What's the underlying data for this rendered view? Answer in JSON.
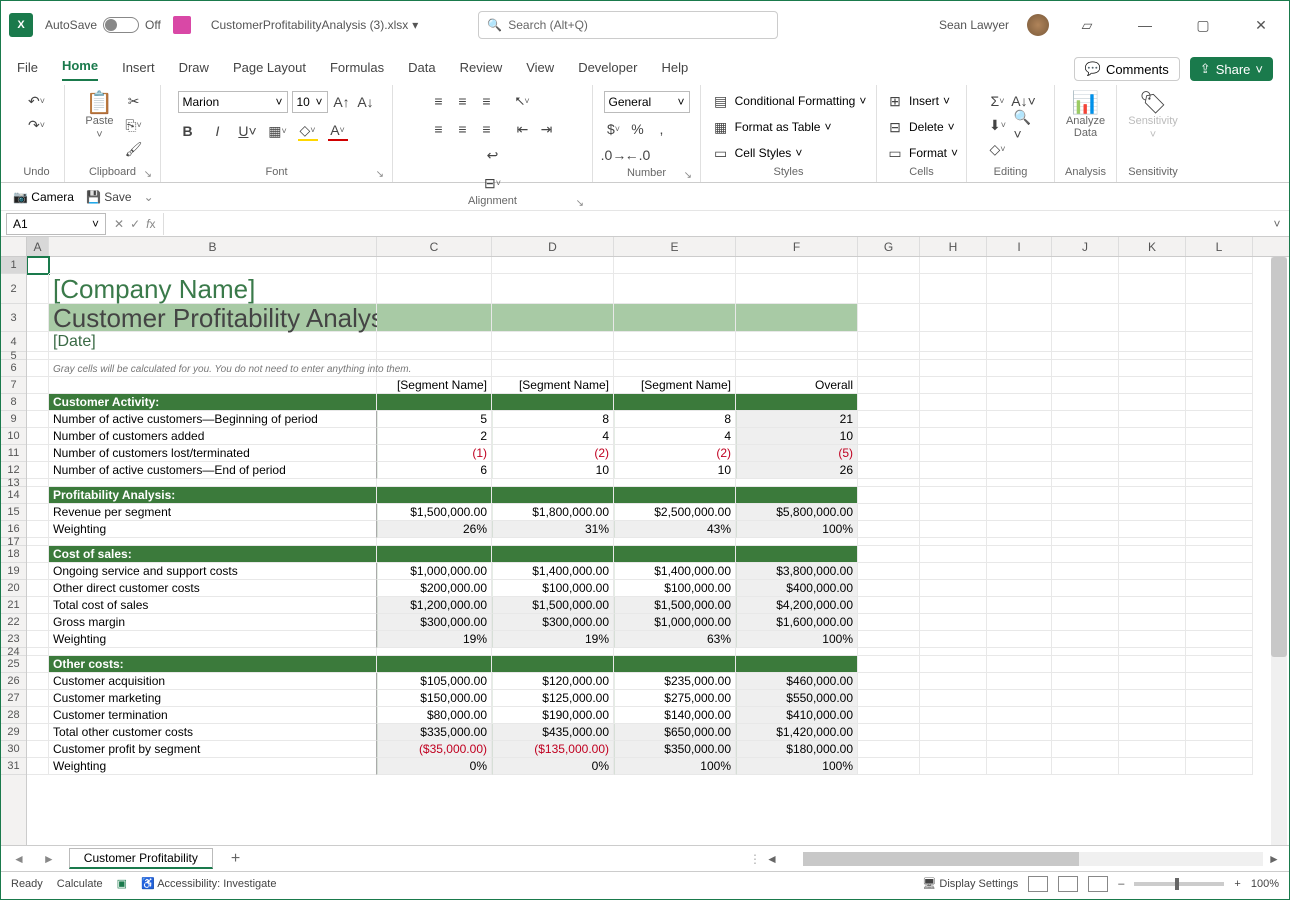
{
  "titlebar": {
    "autosave_label": "AutoSave",
    "autosave_state": "Off",
    "filename": "CustomerProfitabilityAnalysis (3).xlsx",
    "search_placeholder": "Search (Alt+Q)",
    "username": "Sean Lawyer"
  },
  "tabs": {
    "items": [
      "File",
      "Home",
      "Insert",
      "Draw",
      "Page Layout",
      "Formulas",
      "Data",
      "Review",
      "View",
      "Developer",
      "Help"
    ],
    "comments": "Comments",
    "share": "Share"
  },
  "ribbon": {
    "undo": "Undo",
    "clipboard": "Clipboard",
    "paste": "Paste",
    "font_group": "Font",
    "font_name": "Marion",
    "font_size": "10",
    "alignment": "Alignment",
    "number": "Number",
    "number_format": "General",
    "styles": "Styles",
    "cond_fmt": "Conditional Formatting",
    "fmt_table": "Format as Table",
    "cell_styles": "Cell Styles",
    "cells": "Cells",
    "insert": "Insert",
    "delete": "Delete",
    "format": "Format",
    "editing": "Editing",
    "analysis": "Analysis",
    "analyze": "Analyze\nData",
    "sensitivity": "Sensitivity"
  },
  "qat": {
    "camera": "Camera",
    "save": "Save"
  },
  "namebox": "A1",
  "columns": [
    "A",
    "B",
    "C",
    "D",
    "E",
    "F",
    "G",
    "H",
    "I",
    "J",
    "K",
    "L"
  ],
  "sheet": {
    "company": "[Company Name]",
    "title": "Customer Profitability Analysis",
    "date": "[Date]",
    "helper": "Gray cells will be calculated for you. You do not need to enter anything into them.",
    "seg_hdrs": [
      "[Segment Name]",
      "[Segment Name]",
      "[Segment Name]",
      "Overall"
    ],
    "s1": {
      "h": "Customer Activity:",
      "rows": [
        {
          "l": "Number of active customers—Beginning of period",
          "v": [
            "5",
            "8",
            "8",
            "21"
          ]
        },
        {
          "l": "Number of customers added",
          "v": [
            "2",
            "4",
            "4",
            "10"
          ]
        },
        {
          "l": "Number of customers lost/terminated",
          "v": [
            "(1)",
            "(2)",
            "(2)",
            "(5)"
          ],
          "neg": true
        },
        {
          "l": "Number of active customers—End of period",
          "v": [
            "6",
            "10",
            "10",
            "26"
          ]
        }
      ]
    },
    "s2": {
      "h": "Profitability Analysis:",
      "rows": [
        {
          "l": "Revenue per segment",
          "v": [
            "$1,500,000.00",
            "$1,800,000.00",
            "$2,500,000.00",
            "$5,800,000.00"
          ]
        },
        {
          "l": "Weighting",
          "v": [
            "26%",
            "31%",
            "43%",
            "100%"
          ],
          "gray": true
        }
      ]
    },
    "s3": {
      "h": "Cost of sales:",
      "rows": [
        {
          "l": "Ongoing service and support costs",
          "v": [
            "$1,000,000.00",
            "$1,400,000.00",
            "$1,400,000.00",
            "$3,800,000.00"
          ]
        },
        {
          "l": "Other direct customer costs",
          "v": [
            "$200,000.00",
            "$100,000.00",
            "$100,000.00",
            "$400,000.00"
          ]
        },
        {
          "l": "Total cost of sales",
          "v": [
            "$1,200,000.00",
            "$1,500,000.00",
            "$1,500,000.00",
            "$4,200,000.00"
          ],
          "gray": true
        },
        {
          "l": "Gross margin",
          "v": [
            "$300,000.00",
            "$300,000.00",
            "$1,000,000.00",
            "$1,600,000.00"
          ],
          "gray": true
        },
        {
          "l": "Weighting",
          "v": [
            "19%",
            "19%",
            "63%",
            "100%"
          ],
          "gray": true
        }
      ]
    },
    "s4": {
      "h": "Other costs:",
      "rows": [
        {
          "l": "Customer acquisition",
          "v": [
            "$105,000.00",
            "$120,000.00",
            "$235,000.00",
            "$460,000.00"
          ]
        },
        {
          "l": "Customer marketing",
          "v": [
            "$150,000.00",
            "$125,000.00",
            "$275,000.00",
            "$550,000.00"
          ]
        },
        {
          "l": "Customer termination",
          "v": [
            "$80,000.00",
            "$190,000.00",
            "$140,000.00",
            "$410,000.00"
          ]
        },
        {
          "l": "Total other customer costs",
          "v": [
            "$335,000.00",
            "$435,000.00",
            "$650,000.00",
            "$1,420,000.00"
          ],
          "gray": true
        },
        {
          "l": "Customer profit by segment",
          "v": [
            "($35,000.00)",
            "($135,000.00)",
            "$350,000.00",
            "$180,000.00"
          ],
          "gray": true,
          "negcols": [
            0,
            1
          ]
        },
        {
          "l": "Weighting",
          "v": [
            "0%",
            "0%",
            "100%",
            "100%"
          ],
          "gray": true
        }
      ]
    }
  },
  "sheettab": "Customer Profitability",
  "status": {
    "ready": "Ready",
    "calc": "Calculate",
    "access": "Accessibility: Investigate",
    "display": "Display Settings",
    "zoom": "100%"
  }
}
